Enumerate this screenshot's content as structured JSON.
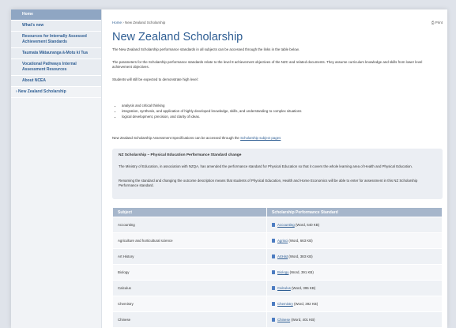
{
  "sidebar": {
    "items": [
      {
        "label": "Home"
      },
      {
        "label": "What's new"
      },
      {
        "label": "Resources for Internally Assessed Achievement Standards"
      },
      {
        "label": "Taumata Mātauranga ā-Motu ki Tua"
      },
      {
        "label": "Vocational Pathways Internal Assessment Resources"
      },
      {
        "label": "About NCEA"
      },
      {
        "label": "› New Zealand Scholarship"
      }
    ]
  },
  "breadcrumb": {
    "home": "Home",
    "sep": " › ",
    "current": "New Zealand Scholarship"
  },
  "print_label": "Print",
  "title": "New Zealand Scholarship",
  "intro": [
    "The New Zealand Scholarship performance standards in all subjects can be accessed through the links in the table below.",
    "The parameters for the Scholarship performance standards relate to the level 8 achievement objectives of the NZC and related documents. They assume curriculum knowledge and skills from lower level achievement objectives.",
    "Students will still be expected to demonstrate high level:"
  ],
  "bullets": [
    "analysis and critical thinking",
    "integration, synthesis, and application of highly developed knowledge, skills, and understanding to complex situations",
    "logical development, precision, and clarity of ideas."
  ],
  "spec_text": "New Zealand Scholarship Assessment Specifications can be accessed through the ",
  "spec_link": "Scholarship subject pages",
  "notice": {
    "title": "NZ Scholarship – Physical Education Performance Standard change",
    "p1": "The Ministry of Education, in association with NZQA, has amended the performance standard for Physical Education so that it covers the whole learning area of Health and Physical Education.",
    "p2": "Renaming the standard and changing the outcome description means that students of Physical Education, Health and Home Economics will be able to enter for assessment in this NZ Scholarship Performance standard."
  },
  "table": {
    "headers": [
      "Subject",
      "Scholarship Performance Standard"
    ],
    "rows": [
      {
        "subject": "Accounting",
        "link": "Accounting",
        "meta": " (Word, 640 KB)"
      },
      {
        "subject": "Agriculture and horticultural science",
        "link": "Agrisci",
        "meta": " (Word, 663 KB)"
      },
      {
        "subject": "Art History",
        "link": "ArtHist",
        "meta": " (Word, 383 KB)"
      },
      {
        "subject": "Biology",
        "link": "Biology",
        "meta": " (Word, 391 KB)"
      },
      {
        "subject": "Calculus",
        "link": "Calculus",
        "meta": " (Word, 395 KB)"
      },
      {
        "subject": "Chemistry",
        "link": "Chemistry",
        "meta": " (Word, 392 KB)"
      },
      {
        "subject": "Chinese",
        "link": "Chinese",
        "meta": " (Word, 401 KB)"
      }
    ]
  }
}
